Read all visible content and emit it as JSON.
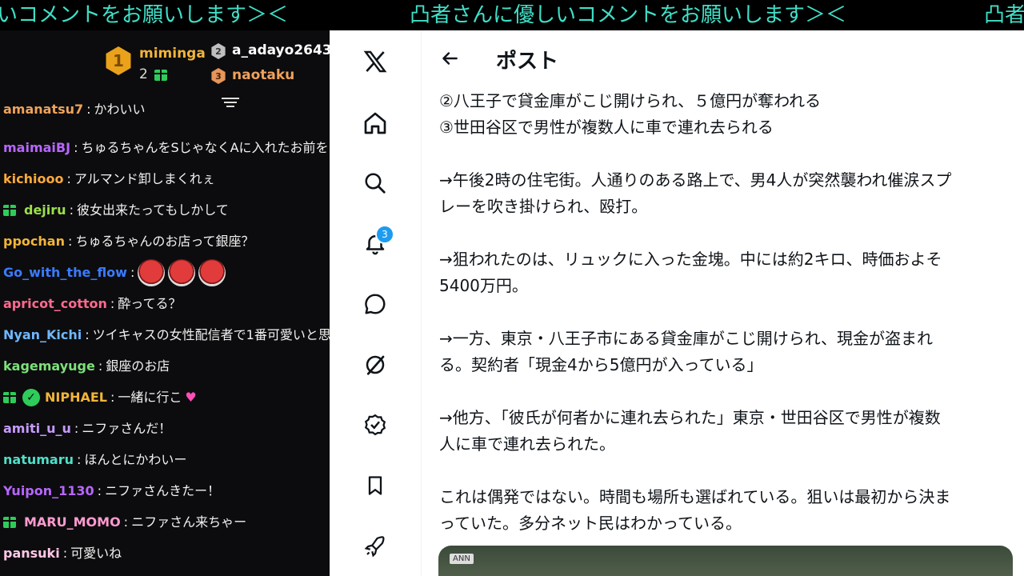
{
  "ticker": {
    "segments": [
      "いコメントをお願いします＞＜",
      "凸者さんに優しいコメントをお願いします＞＜",
      "凸者"
    ]
  },
  "leaderboard": {
    "first": {
      "rank": "1",
      "name": "miminga",
      "gifts": "2"
    },
    "second": {
      "rank": "2",
      "name": "a_adayo2643"
    },
    "third": {
      "rank": "3",
      "name": "naotaku"
    }
  },
  "chat": {
    "messages": [
      {
        "user": "amanatsu7",
        "text": "かわいい",
        "color": "#f0a25a"
      },
      {
        "user": "maimaiBJ",
        "text": "ちゅるちゃんをSじゃなくAに入れたお前を",
        "color": "#b866ff"
      },
      {
        "user": "kichiooo",
        "text": "アルマンド卸しまくれぇ",
        "color": "#ffaa3a"
      },
      {
        "user": "dejiru",
        "text": "彼女出来たってもしかして",
        "color": "#9be04a"
      },
      {
        "user": "ppochan",
        "text": "ちゅるちゃんのお店って銀座？",
        "color": "#f2b53a"
      },
      {
        "user": "Go_with_the_flow",
        "text": "",
        "color": "#3a7bff"
      },
      {
        "user": "apricot_cotton",
        "text": "酔ってる？",
        "color": "#ff6a8e"
      },
      {
        "user": "Nyan_Kichi",
        "text": "ツイキャスの女性配信者で1番可愛いと思",
        "color": "#6fb8ff"
      },
      {
        "user": "kagemayuge",
        "text": "銀座のお店",
        "color": "#7de07a"
      },
      {
        "user": "NIPHAEL",
        "text": "一緒に行こ",
        "color": "#f2b53a"
      },
      {
        "user": "amiti_u_u",
        "text": "ニファさんだ！",
        "color": "#c79bff"
      },
      {
        "user": "natumaru",
        "text": "ほんとにかわいー",
        "color": "#4fe0c8"
      },
      {
        "user": "Yuipon_1130",
        "text": "ニファさんきたー！",
        "color": "#b866ff"
      },
      {
        "user": "MARU_MOMO",
        "text": "ニファさん来ちゃー",
        "color": "#ff9ad0"
      },
      {
        "user": "pansuki",
        "text": "可愛いね",
        "color": "#ffc8e6"
      }
    ]
  },
  "x_nav": {
    "notifications_count": "3",
    "icons": [
      "x-logo-icon",
      "home-icon",
      "search-icon",
      "bell-icon",
      "message-icon",
      "grok-icon",
      "verified-icon",
      "bookmark-icon",
      "rocket-icon"
    ]
  },
  "post": {
    "title": "ポスト",
    "lines": [
      "②八王子で貸金庫がこじ開けられ、５億円が奪われる",
      "③世田谷区で男性が複数人に車で連れ去られる",
      "",
      "→午後2時の住宅街。人通りのある路上で、男4人が突然襲われ催涙スプ",
      "レーを吹き掛けられ、殴打。",
      "",
      "→狙われたのは、リュックに入った金塊。中には約2キロ、時価およそ",
      "5400万円。",
      "",
      "→一方、東京・八王子市にある貸金庫がこじ開けられ、現金が盗まれ",
      "る。契約者「現金4から5億円が入っている」",
      "",
      "→他方、「彼氏が何者かに連れ去られた」東京・世田谷区で男性が複数",
      "人に車で連れ去られた。",
      "",
      "これは偶発ではない。時間も場所も選ばれている。狙いは最初から決ま",
      "っていた。多分ネット民はわかっている。"
    ],
    "media_label": "ANN"
  }
}
